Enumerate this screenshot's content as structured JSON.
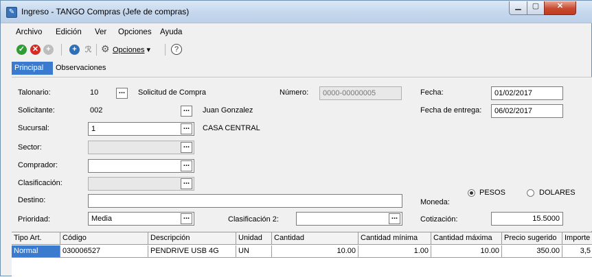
{
  "window": {
    "title": "Ingreso - TANGO Compras (Jefe de compras)"
  },
  "menu": [
    {
      "label": "Archivo"
    },
    {
      "label": "Edición"
    },
    {
      "label": "Ver"
    },
    {
      "label": "Opciones"
    },
    {
      "label": "Ayuda"
    }
  ],
  "toolbar": {
    "options_label": "Opciones",
    "dropdown_glyph": "▾"
  },
  "tabs": [
    {
      "label": "Principal"
    },
    {
      "label": "Observaciones"
    }
  ],
  "form": {
    "talonario": {
      "label": "Talonario:",
      "value": "10",
      "desc": "Solicitud de Compra"
    },
    "numero": {
      "label": "Número:",
      "value": "0000-00000005"
    },
    "fecha": {
      "label": "Fecha:",
      "value": "01/02/2017"
    },
    "solicitante": {
      "label": "Solicitante:",
      "value": "002",
      "desc": "Juan Gonzalez"
    },
    "fecha_entrega": {
      "label": "Fecha de entrega:",
      "value": "06/02/2017"
    },
    "sucursal": {
      "label": "Sucursal:",
      "value": "1",
      "desc": "CASA CENTRAL"
    },
    "sector": {
      "label": "Sector:",
      "value": ""
    },
    "comprador": {
      "label": "Comprador:",
      "value": ""
    },
    "clasificacion": {
      "label": "Clasificación:",
      "value": ""
    },
    "destino": {
      "label": "Destino:",
      "value": ""
    },
    "moneda": {
      "label": "Moneda:",
      "options": [
        "PESOS",
        "DOLARES"
      ],
      "selected": "PESOS"
    },
    "prioridad": {
      "label": "Prioridad:",
      "value": "Media"
    },
    "clasificacion2": {
      "label": "Clasificación 2:",
      "value": ""
    },
    "cotizacion": {
      "label": "Cotización:",
      "value": "15.5000"
    },
    "ellipsis": "..."
  },
  "grid": {
    "headers": [
      "Tipo Art.",
      "Código",
      "Descripción",
      "Unidad",
      "Cantidad",
      "Cantidad mínima",
      "Cantidad máxima",
      "Precio sugerido",
      "Importe"
    ],
    "rows": [
      [
        "Normal",
        "030006527",
        "PENDRIVE USB 4G",
        "UN",
        "10.00",
        "1.00",
        "10.00",
        "350.00",
        "3,5"
      ]
    ]
  },
  "colors": {
    "accent": "#3a7bd0",
    "title_bar": "#c3d6ec",
    "ok": "#2f9c34",
    "cancel": "#d42b25"
  }
}
